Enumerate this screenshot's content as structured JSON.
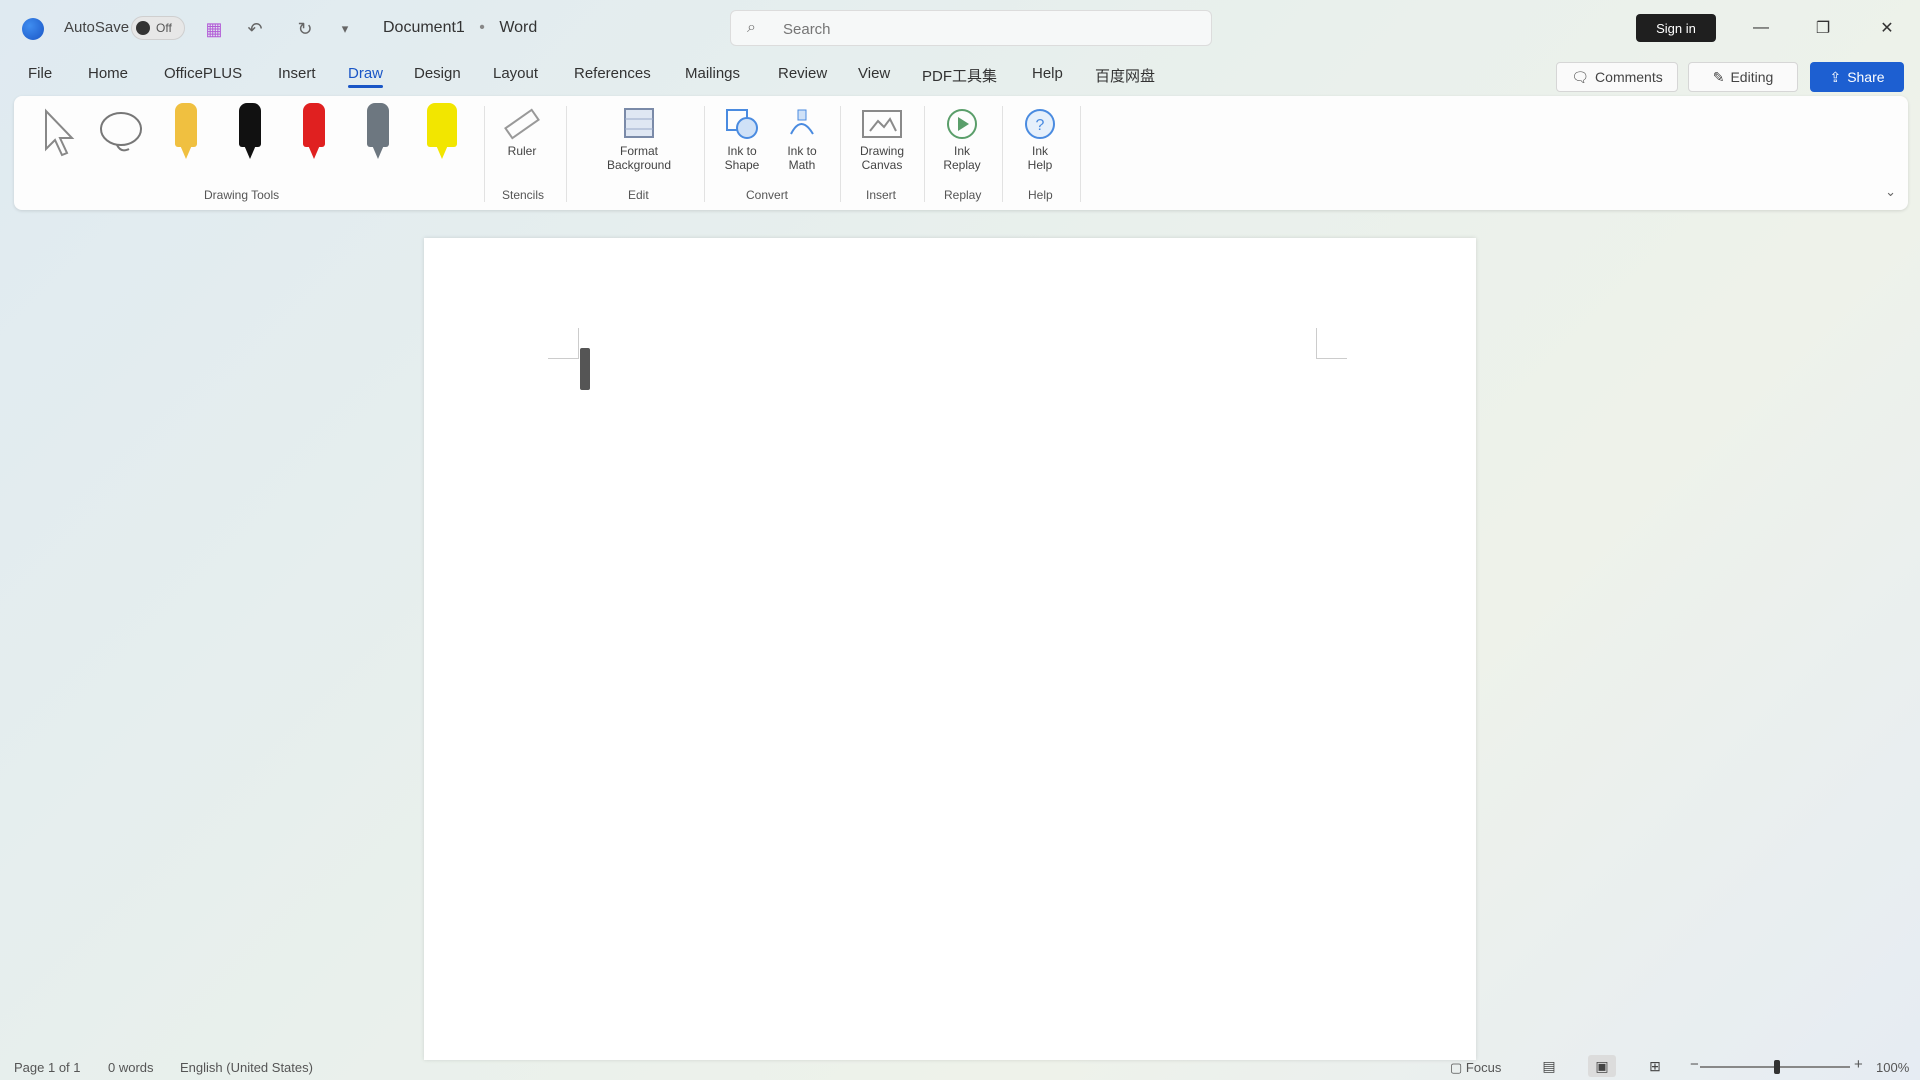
{
  "titlebar": {
    "autosave_label": "AutoSave",
    "autosave_state": "Off",
    "document_title": "Document1",
    "app_name": "Word",
    "title_separator": "•",
    "search_placeholder": "Search",
    "signin_label": "Sign in",
    "icons": {
      "logo": "word-logo",
      "copilot": "copilot-icon",
      "undo": "undo-icon",
      "redo": "redo-icon",
      "customize": "chevron-down-icon"
    }
  },
  "tabs": [
    "File",
    "Home",
    "OfficePLUS",
    "Insert",
    "Draw",
    "Design",
    "Layout",
    "References",
    "Mailings",
    "Review",
    "View",
    "PDF工具集",
    "Help",
    "百度网盘"
  ],
  "active_tab": "Draw",
  "actions": {
    "comments": "Comments",
    "editing": "Editing",
    "share": "Share"
  },
  "ribbon": {
    "drawing_tools_label": "Drawing Tools",
    "stencils_label": "Stencils",
    "edit_label": "Edit",
    "convert_label": "Convert",
    "insert_label": "Insert",
    "replay_label": "Replay",
    "help_label": "Help",
    "ruler": "Ruler",
    "format_background": "Format\nBackground",
    "ink_to_shape": "Ink to\nShape",
    "ink_to_math": "Ink to\nMath",
    "drawing_canvas": "Drawing\nCanvas",
    "ink_replay": "Ink\nReplay",
    "ink_help": "Ink\nHelp",
    "pen_colors": [
      "#f0c040",
      "#111111",
      "#e02020",
      "#6d7780",
      "#f2e600"
    ]
  },
  "statusbar": {
    "page": "Page 1 of 1",
    "words": "0 words",
    "language": "English (United States)",
    "focus": "Focus",
    "zoom": "100%"
  },
  "colors": {
    "accent": "#1a56c6",
    "share": "#1d5fd1"
  }
}
